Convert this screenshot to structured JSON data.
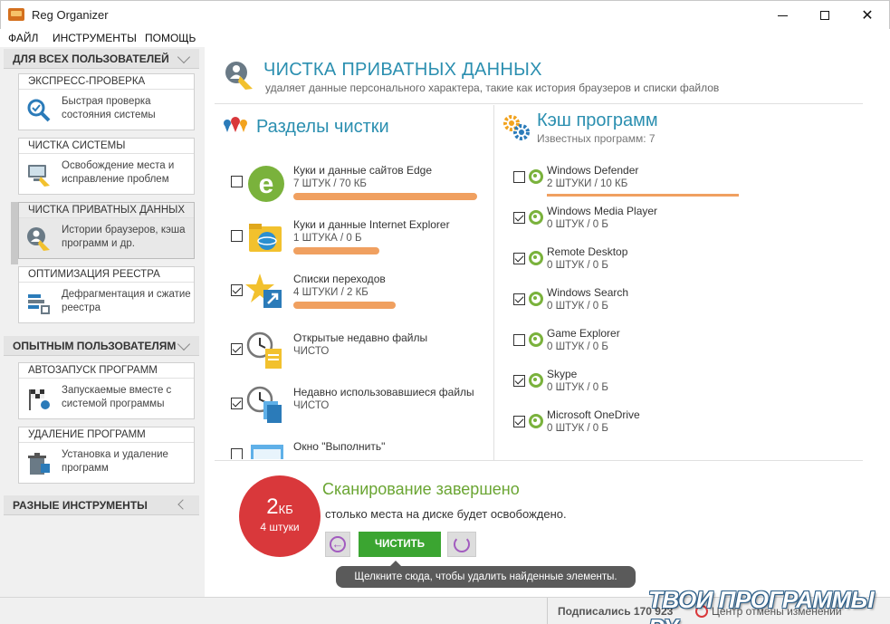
{
  "window": {
    "title": "Reg Organizer"
  },
  "menu": [
    "ФАЙЛ",
    "ИНСТРУМЕНТЫ",
    "ПОМОЩЬ"
  ],
  "sidebar": {
    "section_all_users": "ДЛЯ ВСЕХ ПОЛЬЗОВАТЕЛЕЙ",
    "section_advanced": "ОПЫТНЫМ ПОЛЬЗОВАТЕЛЯМ",
    "section_misc": "РАЗНЫЕ ИНСТРУМЕНТЫ",
    "items": [
      {
        "title": "ЭКСПРЕСС-ПРОВЕРКА",
        "desc": "Быстрая проверка состояния системы"
      },
      {
        "title": "ЧИСТКА СИСТЕМЫ",
        "desc": "Освобождение места и исправление проблем"
      },
      {
        "title": "ЧИСТКА ПРИВАТНЫХ ДАННЫХ",
        "desc": "Истории браузеров, кэша программ и др."
      },
      {
        "title": "ОПТИМИЗАЦИЯ РЕЕСТРА",
        "desc": "Дефрагментация и сжатие реестра"
      },
      {
        "title": "АВТОЗАПУСК ПРОГРАММ",
        "desc": "Запускаемые вместе с системой программы"
      },
      {
        "title": "УДАЛЕНИЕ ПРОГРАММ",
        "desc": "Установка и удаление программ"
      }
    ]
  },
  "main": {
    "title": "ЧИСТКА ПРИВАТНЫХ ДАННЫХ",
    "subtitle": "удаляет данные персонального характера, такие как история браузеров и списки файлов",
    "sections_title": "Разделы чистки",
    "cache_title": "Кэш программ",
    "cache_sub": "Известных программ: 7",
    "sections": [
      {
        "title": "Куки и данные сайтов Edge",
        "value": "7 ШТУК / 70 КБ",
        "checked": false,
        "fill": 0.9
      },
      {
        "title": "Куки и данные Internet Explorer",
        "value": "1 ШТУКА / 0 Б",
        "checked": false,
        "fill": 0.42
      },
      {
        "title": "Списки переходов",
        "value": "4 ШТУКИ / 2 КБ",
        "checked": true,
        "fill": 0.5
      },
      {
        "title": "Открытые недавно файлы",
        "value": "ЧИСТО",
        "checked": true,
        "fill": 0
      },
      {
        "title": "Недавно использовавшиеся файлы",
        "value": "ЧИСТО",
        "checked": true,
        "fill": 0
      },
      {
        "title": "Окно \"Выполнить\"",
        "value": "",
        "checked": false,
        "fill": 0
      }
    ],
    "cache": [
      {
        "title": "Windows Defender",
        "value": "2 ШТУКИ / 10 КБ",
        "checked": false,
        "fill": 0.9
      },
      {
        "title": "Windows Media Player",
        "value": "0 ШТУК / 0 Б",
        "checked": true,
        "fill": 0
      },
      {
        "title": "Remote Desktop",
        "value": "0 ШТУК / 0 Б",
        "checked": true,
        "fill": 0
      },
      {
        "title": "Windows Search",
        "value": "0 ШТУК / 0 Б",
        "checked": true,
        "fill": 0
      },
      {
        "title": "Game Explorer",
        "value": "0 ШТУК / 0 Б",
        "checked": false,
        "fill": 0
      },
      {
        "title": "Skype",
        "value": "0 ШТУК / 0 Б",
        "checked": true,
        "fill": 0
      },
      {
        "title": "Microsoft OneDrive",
        "value": "0 ШТУК / 0 Б",
        "checked": true,
        "fill": 0
      }
    ],
    "result": {
      "size_num": "2",
      "size_unit": "КБ",
      "count": "4 штуки",
      "title": "Сканирование завершено",
      "subtitle": "столько места на диске будет освобождено.",
      "clean_button": "ЧИСТИТЬ",
      "tooltip": "Щелкните сюда, чтобы удалить найденные элементы."
    }
  },
  "status": {
    "subscribed": "Подписались 170 923",
    "undo_center": "Центр отмены изменений",
    "watermark": "ТВОИ ПРОГРАММЫ РУ"
  },
  "colors": {
    "accent": "#2b8fb0",
    "green": "#3ba531",
    "red": "#d9383b",
    "bar": "#f0a060"
  }
}
